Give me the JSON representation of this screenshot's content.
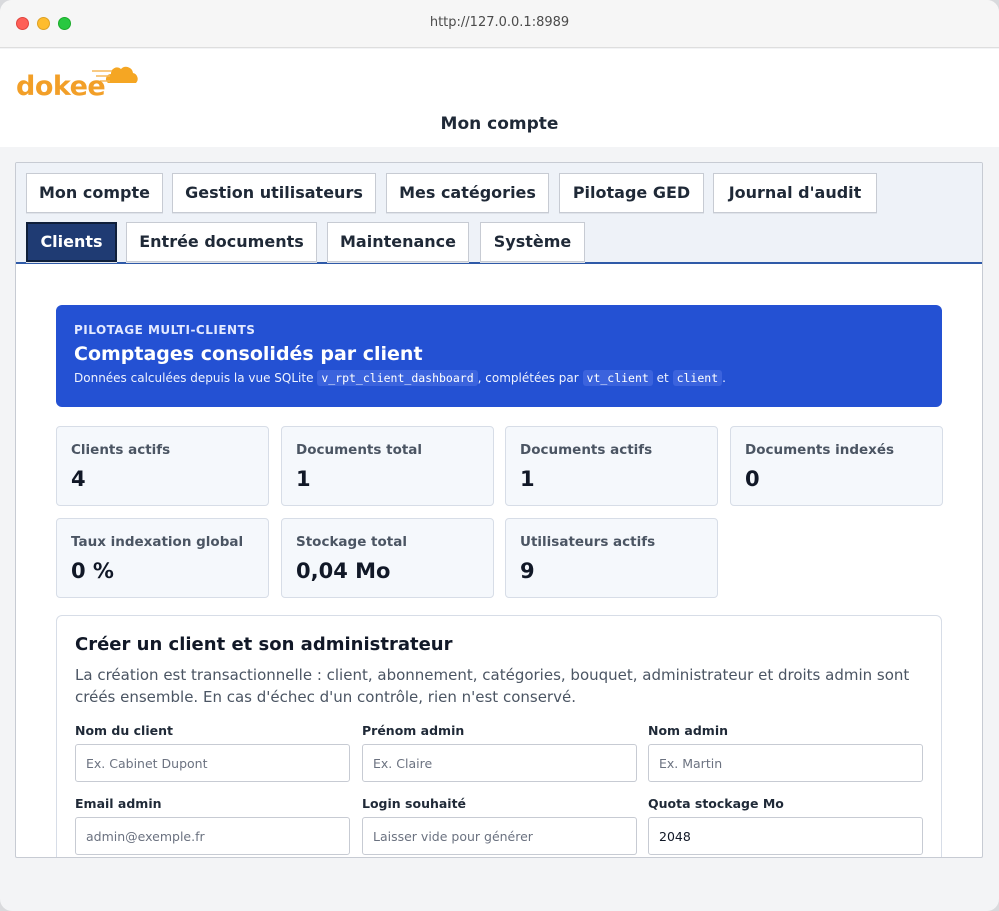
{
  "browser": {
    "url": "http://127.0.0.1:8989"
  },
  "app": {
    "logo_text": "dokee",
    "page_title": "Mon compte"
  },
  "tabs": [
    {
      "label": "Mon compte"
    },
    {
      "label": "Gestion utilisateurs"
    },
    {
      "label": "Mes catégories"
    },
    {
      "label": "Pilotage GED"
    },
    {
      "label": "Journal d'audit"
    },
    {
      "label": "Clients",
      "active": true
    },
    {
      "label": "Entrée documents"
    },
    {
      "label": "Maintenance"
    },
    {
      "label": "Système"
    }
  ],
  "banner": {
    "eyebrow": "PILOTAGE MULTI-CLIENTS",
    "title": "Comptages consolidés par client",
    "desc_prefix": "Données calculées depuis la vue SQLite",
    "code_view": "v_rpt_client_dashboard",
    "desc_middle": ", complétées par",
    "code_table1": "vt_client",
    "desc_and": "et",
    "code_table2": "client",
    "desc_suffix": "."
  },
  "stats": [
    {
      "label": "Clients actifs",
      "value": "4"
    },
    {
      "label": "Documents total",
      "value": "1"
    },
    {
      "label": "Documents actifs",
      "value": "1"
    },
    {
      "label": "Documents indexés",
      "value": "0"
    },
    {
      "label": "Taux indexation global",
      "value": "0 %"
    },
    {
      "label": "Stockage total",
      "value": "0,04 Mo"
    },
    {
      "label": "Utilisateurs actifs",
      "value": "9"
    }
  ],
  "form": {
    "title": "Créer un client et son administrateur",
    "description": "La création est transactionnelle : client, abonnement, catégories, bouquet, administrateur et droits admin sont créés ensemble. En cas d'échec d'un contrôle, rien n'est conservé.",
    "fields": {
      "client_name": {
        "label": "Nom du client",
        "placeholder": "Ex. Cabinet Dupont",
        "value": ""
      },
      "admin_firstname": {
        "label": "Prénom admin",
        "placeholder": "Ex. Claire",
        "value": ""
      },
      "admin_lastname": {
        "label": "Nom admin",
        "placeholder": "Ex. Martin",
        "value": ""
      },
      "admin_email": {
        "label": "Email admin",
        "placeholder": "admin@exemple.fr",
        "value": ""
      },
      "login": {
        "label": "Login souhaité",
        "placeholder": "Laisser vide pour générer",
        "value": ""
      },
      "quota": {
        "label": "Quota stockage Mo",
        "placeholder": "",
        "value": "2048"
      }
    }
  },
  "colors": {
    "accent": "#2451d3",
    "active_tab": "#1f3b73",
    "logo": "#f29f28"
  }
}
